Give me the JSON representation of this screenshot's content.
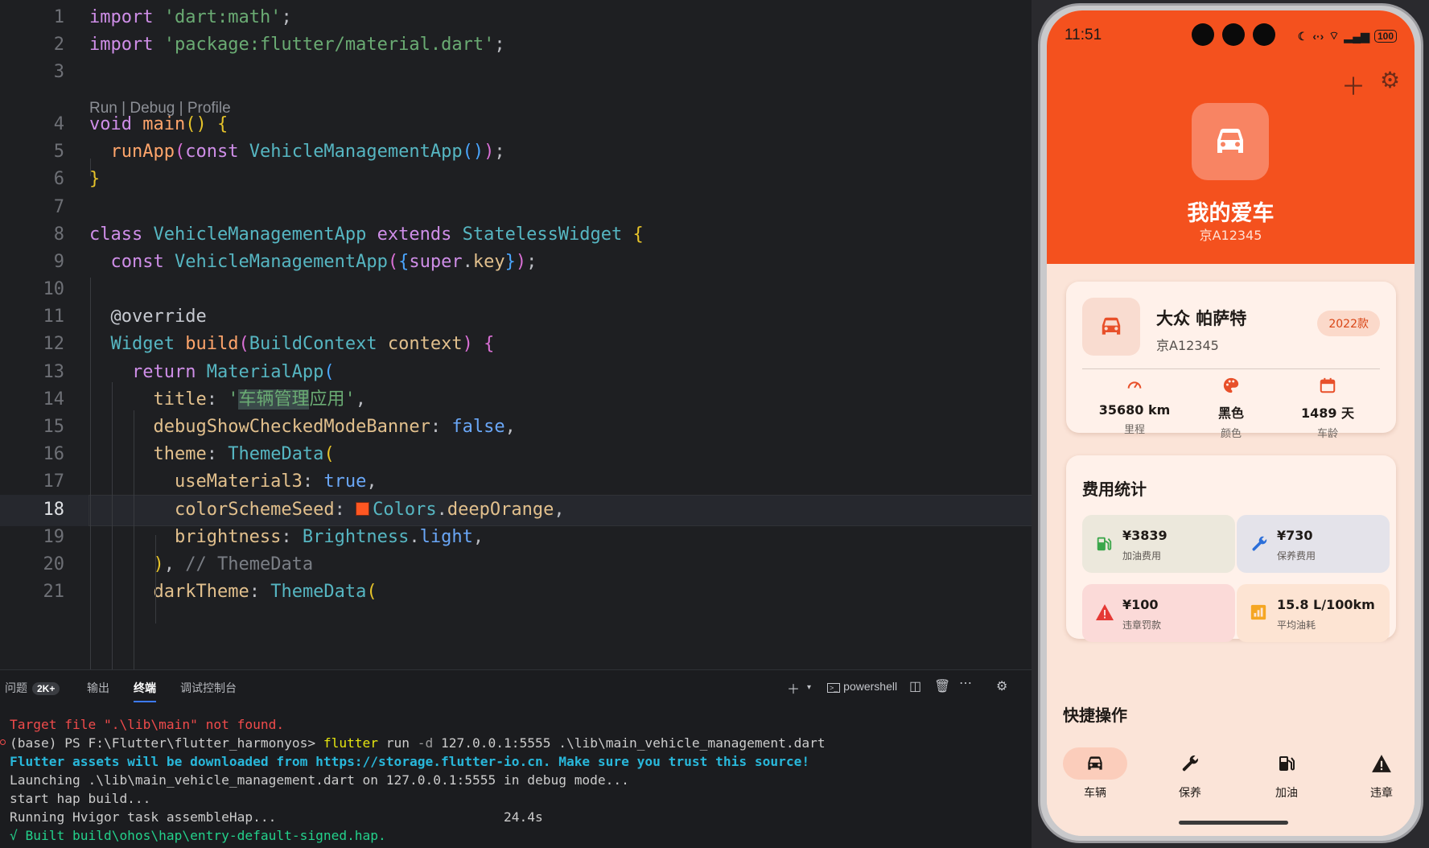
{
  "editor": {
    "lines": [
      {
        "n": "1",
        "html": "<span class='k'>import</span> <span class='s'>'dart:math'</span>;"
      },
      {
        "n": "2",
        "html": "<span class='k'>import</span> <span class='s'>'package:flutter/material.dart'</span>;"
      },
      {
        "n": "3",
        "html": ""
      },
      {
        "n": "4",
        "html": "<span class='k'>void</span> <span class='f'>main</span><span class='b1'>()</span> <span class='b1'>{</span>"
      },
      {
        "n": "5",
        "html": "  <span class='f'>runApp</span><span class='b2'>(</span><span class='k'>const</span> <span class='c'>VehicleManagementApp</span><span class='b3'>()</span><span class='b2'>)</span>;"
      },
      {
        "n": "6",
        "html": "<span class='b1'>}</span>"
      },
      {
        "n": "7",
        "html": ""
      },
      {
        "n": "8",
        "html": "<span class='k'>class</span> <span class='c'>VehicleManagementApp</span> <span class='k'>extends</span> <span class='c'>StatelessWidget</span> <span class='b1'>{</span>"
      },
      {
        "n": "9",
        "html": "  <span class='k'>const</span> <span class='c'>VehicleManagementApp</span><span class='b2'>(</span><span class='b3'>{</span><span class='k'>super</span>.<span class='p'>key</span><span class='b3'>}</span><span class='b2'>)</span>;"
      },
      {
        "n": "10",
        "html": ""
      },
      {
        "n": "11",
        "html": "  <span class='an'>@override</span>"
      },
      {
        "n": "12",
        "html": "  <span class='c'>Widget</span> <span class='f'>build</span><span class='b2'>(</span><span class='c'>BuildContext</span> <span class='p'>context</span><span class='b2'>)</span> <span class='b2'>{</span>"
      },
      {
        "n": "13",
        "html": "    <span class='k'>return</span> <span class='c'>MaterialApp</span><span class='b3'>(</span>"
      },
      {
        "n": "14",
        "html": "      <span class='p'>title</span>: <span class='s'>'<span class='sel'>车辆管理</span>应用'</span>,"
      },
      {
        "n": "15",
        "html": "      <span class='p'>debugShowCheckedModeBanner</span>: <span class='kb'>false</span>,"
      },
      {
        "n": "16",
        "html": "      <span class='p'>theme</span>: <span class='c'>ThemeData</span><span class='b1'>(</span>"
      },
      {
        "n": "17",
        "html": "        <span class='p'>useMaterial3</span>: <span class='kb'>true</span>,"
      },
      {
        "n": "18",
        "html": "        <span class='p'>colorSchemeSeed</span>: <span class='swatch'></span><span class='c'>Colors</span>.<span class='p'>deepOrange</span>,"
      },
      {
        "n": "19",
        "html": "        <span class='p'>brightness</span>: <span class='c'>Brightness</span>.<span class='kb'>light</span>,"
      },
      {
        "n": "20",
        "html": "      <span class='b1'>)</span>, <span class='cm'>// ThemeData</span>"
      },
      {
        "n": "21",
        "html": "      <span class='p'>darkTheme</span>: <span class='c'>ThemeData</span><span class='b1'>(</span>"
      }
    ],
    "codelens": "Run | Debug | Profile",
    "current_line": "18"
  },
  "panel": {
    "tabs": {
      "problems": "问题",
      "problems_count": "2K+",
      "output": "输出",
      "terminal": "终端",
      "debug": "调试控制台"
    },
    "shell": "powershell",
    "lines": [
      {
        "cls": "t-red",
        "text": "Target file \".\\lib\\main\" not found."
      },
      {
        "cls": "",
        "html": "(base) PS F:\\Flutter\\flutter_harmonyos> <span class='t-yellow'>flutter</span> run <span style='color:#9a9a9a'>-d</span> 127.0.0.1:5555 .\\lib\\main_vehicle_management.dart"
      },
      {
        "cls": "t-cyan",
        "text": "Flutter assets will be downloaded from https://storage.flutter-io.cn. Make sure you trust this source!"
      },
      {
        "cls": "",
        "text": "Launching .\\lib\\main_vehicle_management.dart on 127.0.0.1:5555 in debug mode..."
      },
      {
        "cls": "",
        "text": "start hap build..."
      },
      {
        "cls": "",
        "text": "Running Hvigor task assembleHap...                             24.4s"
      },
      {
        "cls": "t-green",
        "text": "√ Built build\\ohos\\hap\\entry-default-signed.hap."
      }
    ]
  },
  "phone": {
    "status_time": "11:51",
    "battery": "100",
    "car_name": "我的爱车",
    "plate": "京A12345",
    "vehicle": {
      "name": "大众 帕萨特",
      "plate": "京A12345",
      "year": "2022款"
    },
    "stats": [
      {
        "value": "35680 km",
        "label": "里程",
        "icon": "speedometer-icon"
      },
      {
        "value": "黑色",
        "label": "颜色",
        "icon": "palette-icon"
      },
      {
        "value": "1489 天",
        "label": "车龄",
        "icon": "calendar-icon"
      }
    ],
    "expense_title": "费用统计",
    "expenses": [
      {
        "value": "¥3839",
        "label": "加油费用",
        "bg": "#ece8dc"
      },
      {
        "value": "¥730",
        "label": "保养费用",
        "bg": "#e4e3ea"
      },
      {
        "value": "¥100",
        "label": "违章罚款",
        "bg": "#fbdad8"
      },
      {
        "value": "15.8 L/100km",
        "label": "平均油耗",
        "bg": "#fde4d3"
      }
    ],
    "quick_title": "快捷操作",
    "nav": [
      {
        "label": "车辆",
        "icon": "car-icon"
      },
      {
        "label": "保养",
        "icon": "wrench-icon"
      },
      {
        "label": "加油",
        "icon": "fuel-icon"
      },
      {
        "label": "违章",
        "icon": "warning-icon"
      }
    ],
    "colors": {
      "primary": "#f4511e",
      "accent": "#d94515"
    }
  }
}
